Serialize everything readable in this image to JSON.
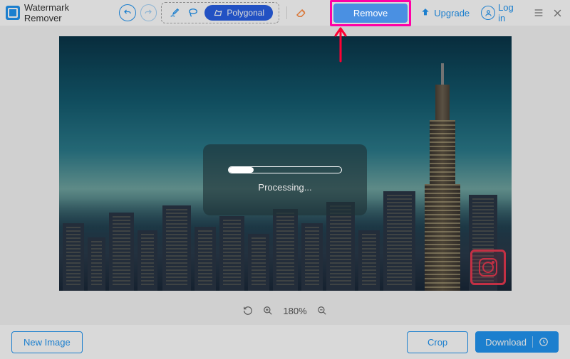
{
  "app": {
    "title": "Watermark Remover"
  },
  "toolbar": {
    "polygonal_label": "Polygonal",
    "remove_label": "Remove",
    "upgrade_label": "Upgrade",
    "login_label": "Log in"
  },
  "processing": {
    "label": "Processing...",
    "progress_percent": 22
  },
  "zoom": {
    "level": "180%"
  },
  "bottom": {
    "new_image_label": "New Image",
    "crop_label": "Crop",
    "download_label": "Download"
  },
  "colors": {
    "accent": "#2196f3",
    "highlight": "#ff00a6",
    "arrow": "#ff0033"
  }
}
